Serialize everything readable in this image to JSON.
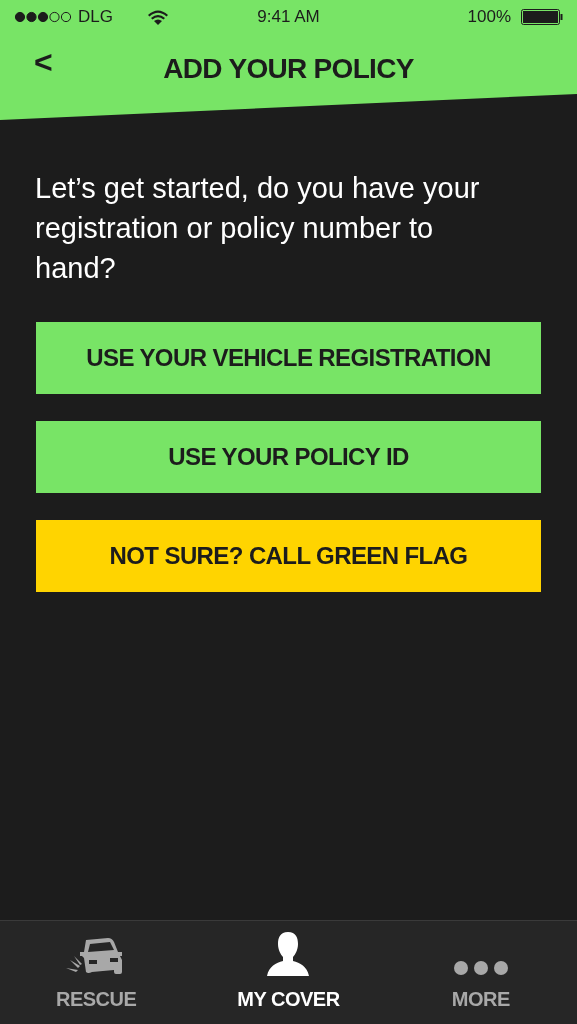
{
  "status_bar": {
    "carrier": "DLG",
    "time": "9:41 AM",
    "battery": "100%"
  },
  "header": {
    "back": "<",
    "title": "ADD YOUR POLICY"
  },
  "prompt": "Let’s get started, do you have your registration or policy number to hand?",
  "buttons": [
    {
      "label": "USE YOUR VEHICLE REGISTRATION",
      "kind": "primary"
    },
    {
      "label": "USE YOUR POLICY ID",
      "kind": "primary"
    },
    {
      "label": "NOT SURE? CALL GREEN FLAG",
      "kind": "warning"
    }
  ],
  "tab_bar": [
    {
      "label": "RESCUE",
      "kind": "car",
      "selected": false
    },
    {
      "label": "MY COVER",
      "kind": "person",
      "selected": true
    },
    {
      "label": "MORE",
      "kind": "dots",
      "selected": false
    }
  ]
}
